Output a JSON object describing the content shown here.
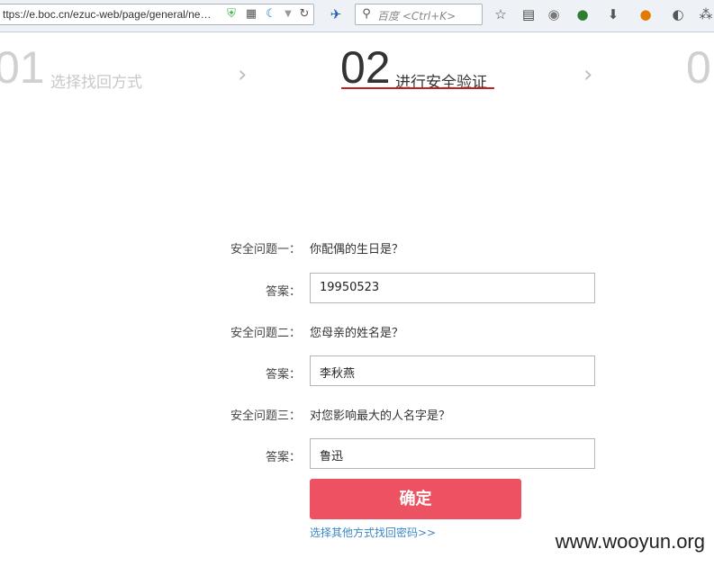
{
  "browser": {
    "url": "ttps://e.boc.cn/ezuc-web/page/general/ne…",
    "search_placeholder": "百度 <Ctrl+K>",
    "icons": [
      "shield-check-icon",
      "qr-code-icon",
      "crescent-icon",
      "dropdown-icon",
      "reload-icon",
      "bird-icon",
      "search-icon",
      "star-icon",
      "reading-list-icon",
      "globe-icon",
      "green-addon-icon",
      "download-icon",
      "firebug-icon",
      "palette-icon",
      "overflow-icon"
    ]
  },
  "steps": [
    {
      "number": "01",
      "title": "选择找回方式",
      "active": false
    },
    {
      "number": "02",
      "title": "进行安全验证",
      "active": true
    },
    {
      "number": "0",
      "title": "",
      "active": false
    }
  ],
  "step_arrow": "›",
  "form": {
    "questions": [
      {
        "label": "安全问题一：",
        "question": "你配偶的生日是？",
        "answer_label": "答案：",
        "answer": "19950523"
      },
      {
        "label": "安全问题二：",
        "question": "您母亲的姓名是？",
        "answer_label": "答案：",
        "answer": "李秋燕"
      },
      {
        "label": "安全问题三：",
        "question": "对您影响最大的人名字是？",
        "answer_label": "答案：",
        "answer": "鲁迅"
      }
    ],
    "confirm_label": "确定",
    "other_method_link": "选择其他方式找回密码>>"
  },
  "watermark": "www.wooyun.org",
  "colors": {
    "accent_red": "#ec5261",
    "underline_red": "#c0201e",
    "link_blue": "#3b87c8"
  }
}
